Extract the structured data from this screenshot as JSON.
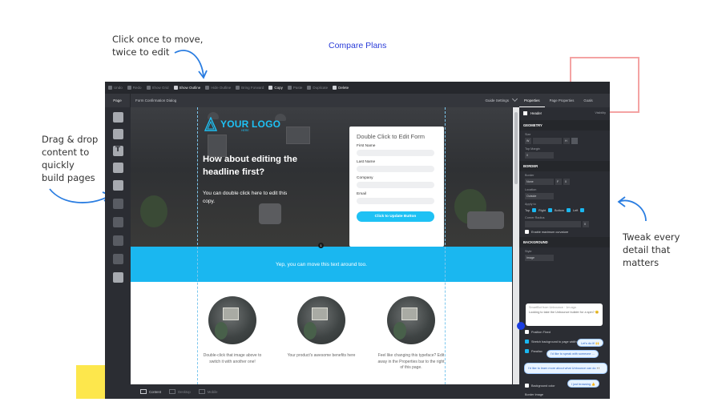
{
  "annotations": {
    "move": [
      "Click once to move,",
      "twice to edit"
    ],
    "drag": [
      "Drag & drop",
      "content to",
      "quickly",
      "build pages"
    ],
    "tweak": [
      "Tweak every",
      "detail that",
      "matters"
    ],
    "compare_link": "Compare Plans"
  },
  "toolbar": {
    "items": [
      "Undo",
      "Redo",
      "Show Grid",
      "Show Outline",
      "Hide Outline",
      "Bring Forward",
      "Copy",
      "Paste",
      "Duplicate",
      "Delete"
    ]
  },
  "subbar": {
    "page_tab": "Page",
    "page_name": "Form Confirmation Dialog",
    "guide": "Guide Settings"
  },
  "left_tools": [
    "section-icon",
    "box-icon",
    "text-icon",
    "image-icon",
    "button-icon",
    "form-icon",
    "list-icon",
    "video-icon",
    "code-icon",
    "social-icon"
  ],
  "hero": {
    "logo_text": "YOUR LOGO",
    "logo_sub": "HERE",
    "headline": "How about editing the headline first?",
    "subcopy": "You can double click here to edit this copy."
  },
  "form": {
    "title": "Double Click to Edit Form",
    "fields": [
      "First Name",
      "Last Name",
      "Company",
      "Email"
    ],
    "button": "Click to Update Button"
  },
  "band": {
    "text": "Yep, you can move this text around too.",
    "marker": "1"
  },
  "features": [
    {
      "caption": "Double-click that image above to switch it with another one!"
    },
    {
      "caption": "Your product's awesome benefits here"
    },
    {
      "caption": "Feel like changing this typeface? Edit away in the Properties bar to the right of this page."
    }
  ],
  "bottombar": [
    "Content",
    "Desktop",
    "Mobile"
  ],
  "panel": {
    "tabs": [
      "Properties",
      "Page Properties",
      "Goals"
    ],
    "element": "Header",
    "visibility": "Visibility",
    "sections": {
      "geometry": "GEOMETRY",
      "size": "Size",
      "size_w": "W",
      "size_h": "H",
      "top_margin": "Top Margin",
      "top_margin_val": "0",
      "border": "BORDER",
      "border_lbl": "Border",
      "border_style": "None",
      "border_px": "0",
      "border_color": "F",
      "location": "Location",
      "location_val": "Outside",
      "apply_to": "Apply to",
      "apply_items": [
        "Top",
        "Right",
        "Bottom",
        "Left"
      ],
      "corner_radius": "Corner Radius",
      "corner_val": "0",
      "enable_radius": "Enable maximum curvature",
      "background": "BACKGROUND",
      "style": "Style",
      "style_val": "Image"
    },
    "chat": {
      "head": "SmartBot from Unbounce · 1m ago",
      "body": "Looking to take the Unbounce builder for a spin? 😊",
      "bubbles": [
        "Let's do it! 🙌",
        "I'd like to speak with someone ...",
        "I'd like to learn more about what Unbounce can do 👀",
        "I just browsing 👍"
      ]
    },
    "checks": [
      "Position Fixed",
      "Stretch background to page width",
      "Parallax"
    ],
    "footer_items": [
      "Background color",
      "Border Image"
    ]
  }
}
